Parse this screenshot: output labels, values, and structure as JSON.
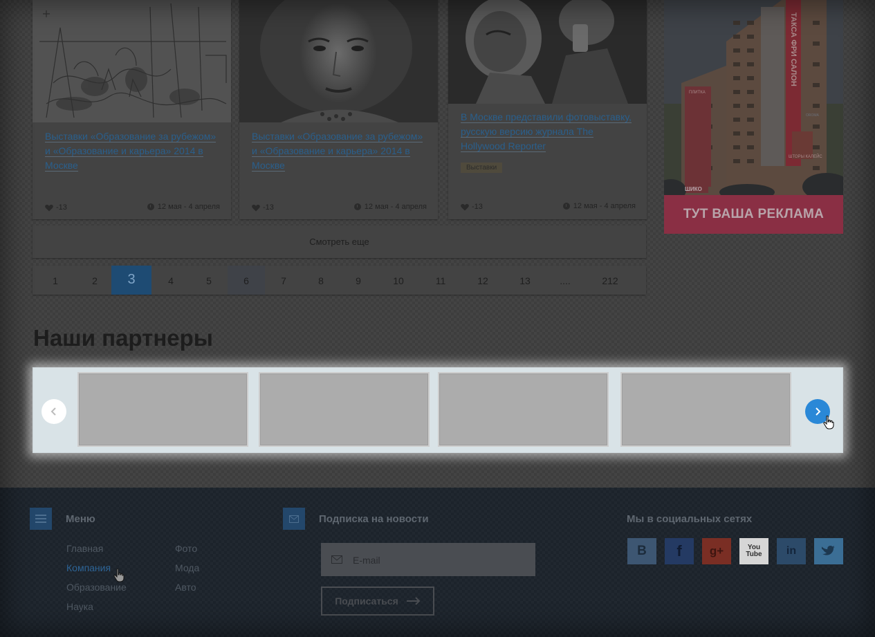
{
  "cards": [
    {
      "title": "Выставки «Образование за рубежом» и «Образование и карьера» 2014 в Москве",
      "likes": "-13",
      "dates": "12 мая - 4 апреля",
      "tag": ""
    },
    {
      "title": "Выставки «Образование за рубежом» и «Образование и карьера» 2014 в Москве",
      "likes": "-13",
      "dates": "12 мая - 4 апреля",
      "tag": ""
    },
    {
      "title": "В Москве представили фотовыставку, русскую версию журнала The Hollywood Reporter",
      "likes": "-13",
      "dates": "12 мая - 4 апреля",
      "tag": "Выставки"
    }
  ],
  "more_label": "Смотреть еще",
  "pagination": {
    "pages": [
      "1",
      "2",
      "3",
      "4",
      "5",
      "6",
      "7",
      "8",
      "9",
      "10",
      "11",
      "12",
      "13",
      "....",
      "212"
    ],
    "current": "3"
  },
  "partners": {
    "title": "Наши партнеры"
  },
  "ad": {
    "banner_text": "ТУТ ВАША РЕКЛАМА",
    "building_sign": "ТАКСА ФРИ САЛОН",
    "sign_plitka": "ПЛИТКА",
    "sign_shtory": "ШТОРЫ КАЛЕЙС",
    "sign_shiko": "ШИКО",
    "sign_oroma": "OROMA"
  },
  "footer": {
    "menu": {
      "heading": "Меню",
      "col1": [
        "Главная",
        "Компания",
        "Образование",
        "Наука"
      ],
      "col2": [
        "Фото",
        "Мода",
        "Авто"
      ],
      "active": "Компания"
    },
    "subscribe": {
      "heading": "Подписка на новости",
      "placeholder": "E-mail",
      "button": "Подписаться"
    },
    "social": {
      "heading": "Мы в социальных сетях",
      "networks": [
        {
          "name": "vk",
          "glyph": "B",
          "color": "#3d5672"
        },
        {
          "name": "facebook",
          "glyph": "f",
          "color": "#243a63"
        },
        {
          "name": "google-plus",
          "glyph": "g+",
          "color": "#7a2e24"
        },
        {
          "name": "youtube",
          "glyph": "You Tube",
          "color": "#d6d6d6"
        },
        {
          "name": "linkedin",
          "glyph": "in",
          "color": "#2c4a69"
        },
        {
          "name": "twitter",
          "glyph": "",
          "color": "#3b6e95"
        }
      ]
    }
  },
  "colors": {
    "accent": "#2a88d7",
    "link": "#2a5f8c",
    "ad_banner": "#8a2f44"
  }
}
